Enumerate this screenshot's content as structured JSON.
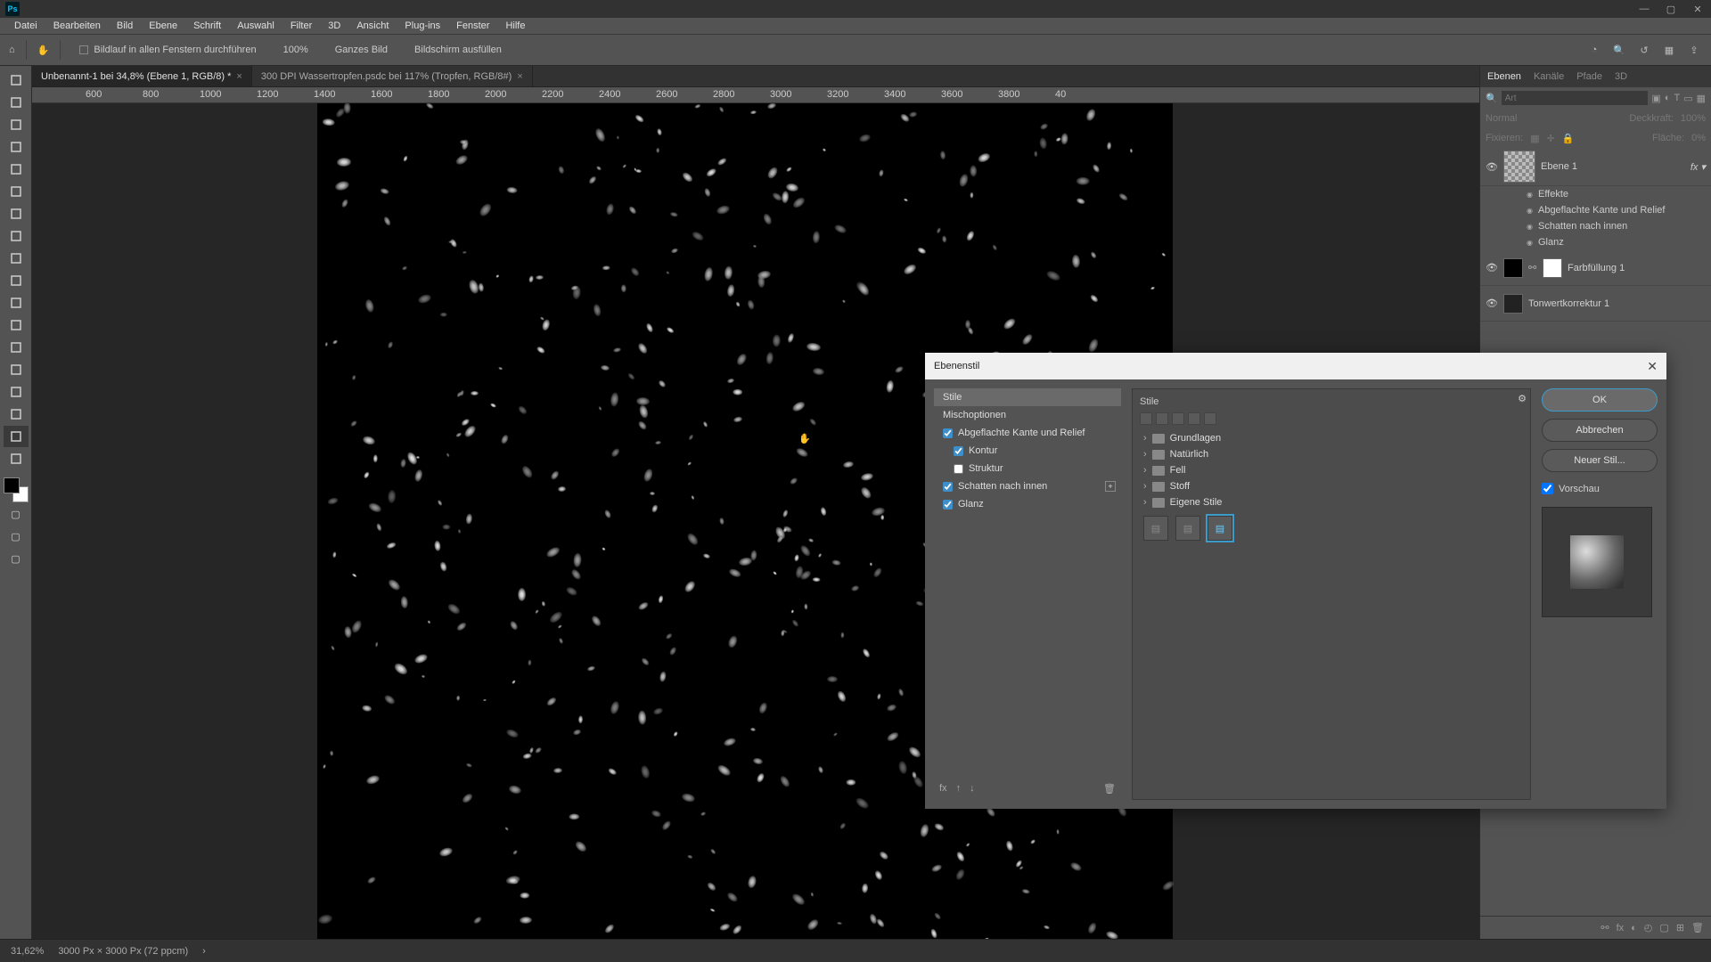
{
  "menu": [
    "Datei",
    "Bearbeiten",
    "Bild",
    "Ebene",
    "Schrift",
    "Auswahl",
    "Filter",
    "3D",
    "Ansicht",
    "Plug-ins",
    "Fenster",
    "Hilfe"
  ],
  "options": {
    "scroll_all": "Bildlauf in allen Fenstern durchführen",
    "zoom": "100%",
    "fit_image": "Ganzes Bild",
    "fill_screen": "Bildschirm ausfüllen"
  },
  "tabs": [
    {
      "label": "Unbenannt-1 bei 34,8% (Ebene 1, RGB/8) *",
      "active": true
    },
    {
      "label": "300 DPI Wassertropfen.psdc bei 117% (Tropfen, RGB/8#)",
      "active": false
    }
  ],
  "ruler_ticks": [
    "600",
    "800",
    "1000",
    "1200",
    "1400",
    "1600",
    "1800",
    "2000",
    "2200",
    "2400",
    "2600",
    "2800",
    "3000",
    "3200",
    "3400",
    "3600",
    "3800",
    "40"
  ],
  "panels": {
    "tabs": [
      "Ebenen",
      "Kanäle",
      "Pfade",
      "3D"
    ],
    "filter_placeholder": "Art",
    "blend_mode": "Normal",
    "opacity_label": "Deckkraft:",
    "opacity_val": "100%",
    "lock_label": "Fixieren:",
    "fill_label": "Fläche:",
    "fill_val": "0%"
  },
  "layers": [
    {
      "name": "Ebene 1",
      "fx": true,
      "effects_label": "Effekte",
      "effects": [
        "Abgeflachte Kante und Relief",
        "Schatten nach innen",
        "Glanz"
      ]
    },
    {
      "name": "Farbfüllung 1"
    },
    {
      "name": "Tonwertkorrektur 1"
    }
  ],
  "status": {
    "zoom": "31,62%",
    "doc": "3000 Px × 3000 Px (72 ppcm)"
  },
  "dialog": {
    "title": "Ebenenstil",
    "left": {
      "header": "Stile",
      "blending": "Mischoptionen",
      "items": [
        {
          "label": "Abgeflachte Kante und Relief",
          "checked": true,
          "sub": false
        },
        {
          "label": "Kontur",
          "checked": true,
          "sub": true
        },
        {
          "label": "Struktur",
          "checked": false,
          "sub": true
        },
        {
          "label": "Schatten nach innen",
          "checked": true,
          "sub": false,
          "plus": true
        },
        {
          "label": "Glanz",
          "checked": true,
          "sub": false
        }
      ]
    },
    "browser": {
      "header": "Stile",
      "folders": [
        "Grundlagen",
        "Natürlich",
        "Fell",
        "Stoff",
        "Eigene Stile"
      ]
    },
    "buttons": {
      "ok": "OK",
      "cancel": "Abbrechen",
      "newstyle": "Neuer Stil...",
      "preview": "Vorschau"
    }
  }
}
